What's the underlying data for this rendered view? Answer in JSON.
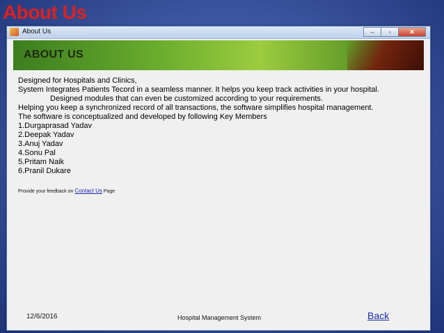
{
  "slide": {
    "title": "About Us"
  },
  "window": {
    "title": "About Us",
    "controls": {
      "minimize": "–",
      "maximize": "▫",
      "close": "✕"
    }
  },
  "banner": {
    "title": "ABOUT US"
  },
  "content": {
    "lines": [
      "Designed for Hospitals and Clinics,",
      "System Integrates Patients Tecord in a seamless manner. It helps you keep track activities in your hospital.",
      "Designed modules that can even be customized according to your requirements.",
      "Helping you keep a synchronized record of all transactions, the software simplifies hospital management.",
      "The software is conceptualized and developed by following Key Members",
      "1.Durgaprasad Yadav",
      "2.Deepak Yadav",
      "3.Anuj Yadav",
      "4.Sonu Pal",
      "5.Pritam Naik",
      "6.Pranil Dukare"
    ]
  },
  "feedback": {
    "prefix": "Provide your feedback on ",
    "link": "Contact Us",
    "suffix": " Page"
  },
  "footer": {
    "date": "12/6/2016",
    "center": "Hospital Management System",
    "back": "Back"
  }
}
